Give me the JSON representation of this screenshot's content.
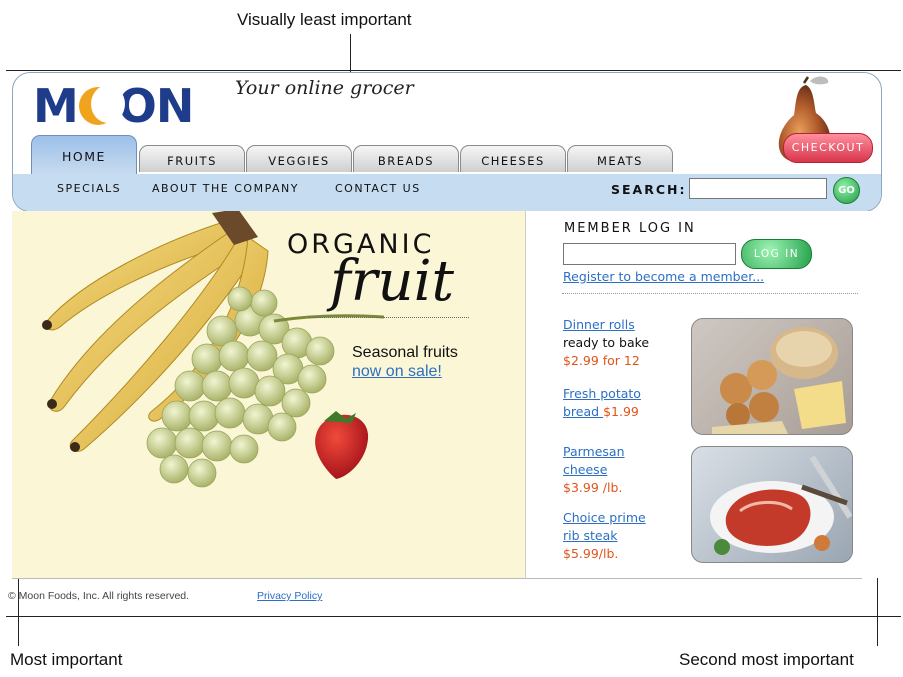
{
  "annotations": {
    "top": "Visually least important",
    "bottom_left": "Most important",
    "bottom_right": "Second most important"
  },
  "header": {
    "logo": "MOON",
    "logo_parts": [
      "M",
      "O",
      "N"
    ],
    "tagline": "Your online grocer",
    "checkout_label": "CHECKOUT"
  },
  "tabs": [
    {
      "label": "HOME",
      "active": true
    },
    {
      "label": "FRUITS",
      "active": false
    },
    {
      "label": "VEGGIES",
      "active": false
    },
    {
      "label": "BREADS",
      "active": false
    },
    {
      "label": "CHEESES",
      "active": false
    },
    {
      "label": "MEATS",
      "active": false
    }
  ],
  "subnav": {
    "links": [
      "SPECIALS",
      "ABOUT THE COMPANY",
      "CONTACT US"
    ],
    "search_label": "SEARCH:",
    "go_label": "GO"
  },
  "hero": {
    "title_top": "ORGANIC",
    "title_bottom": "fruit",
    "subtitle": "Seasonal fruits",
    "link": "now on sale!"
  },
  "login": {
    "title": "MEMBER LOG IN",
    "button": "LOG IN",
    "register": "Register to become a member..."
  },
  "products": [
    {
      "name": [
        "Dinner rolls"
      ],
      "desc": "ready to bake",
      "price": "$2.99 for 12"
    },
    {
      "name": [
        "Fresh potato",
        "bread "
      ],
      "desc": "",
      "price": "$1.99"
    },
    {
      "name": [
        "Parmesan",
        "cheese"
      ],
      "desc": "",
      "price": "$3.99 /lb."
    },
    {
      "name": [
        "Choice prime",
        "rib steak"
      ],
      "desc": "",
      "price": "$5.99/lb."
    }
  ],
  "footer": {
    "copyright": "© Moon Foods, Inc. All rights reserved.",
    "privacy": "Privacy Policy"
  },
  "colors": {
    "brand_blue": "#1f3c8a",
    "moon_orange": "#f0a41e",
    "link_blue": "#2c6fc4",
    "price_orange": "#e0541a",
    "subnav_bg": "#c6dcf1",
    "hero_bg": "#fbf7d6",
    "go_green": "#23a04a",
    "checkout_red": "#d9354c"
  }
}
